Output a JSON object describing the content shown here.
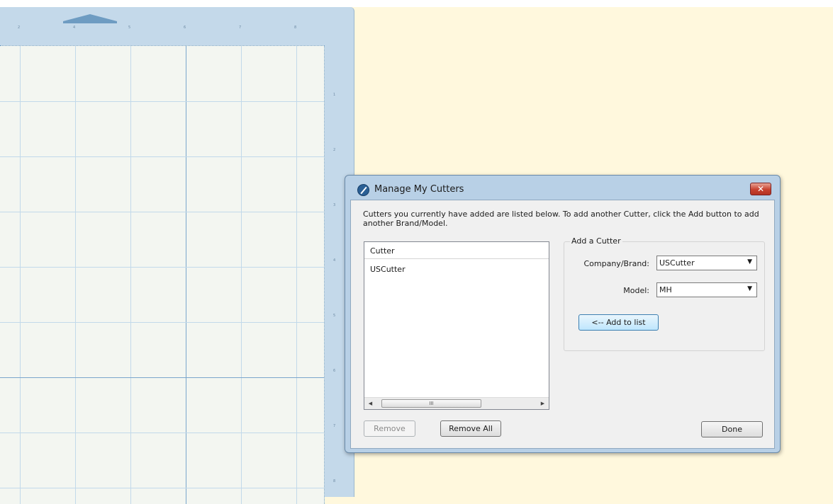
{
  "mat": {
    "ruler_top": [
      "2",
      "4",
      "5",
      "6",
      "7",
      "8"
    ],
    "ruler_right": [
      "1",
      "2",
      "3",
      "4",
      "5",
      "6",
      "7",
      "8"
    ]
  },
  "dialog": {
    "title": "Manage My Cutters",
    "close_glyph": "✕",
    "description": "Cutters you currently have added are listed below. To add another Cutter, click the Add button to add another Brand/Model.",
    "list": {
      "header": "Cutter",
      "items": [
        "USCutter"
      ],
      "scroll_left": "◀",
      "scroll_right": "▶",
      "scroll_thumb": "III"
    },
    "add_group": {
      "legend": "Add a Cutter",
      "brand_label": "Company/Brand:",
      "brand_value": "USCutter",
      "model_label": "Model:",
      "model_value": "MH",
      "dropdown_glyph": "▼",
      "add_button": "<-- Add to list"
    },
    "remove_button": "Remove",
    "remove_all_button": "Remove All",
    "done_button": "Done"
  }
}
